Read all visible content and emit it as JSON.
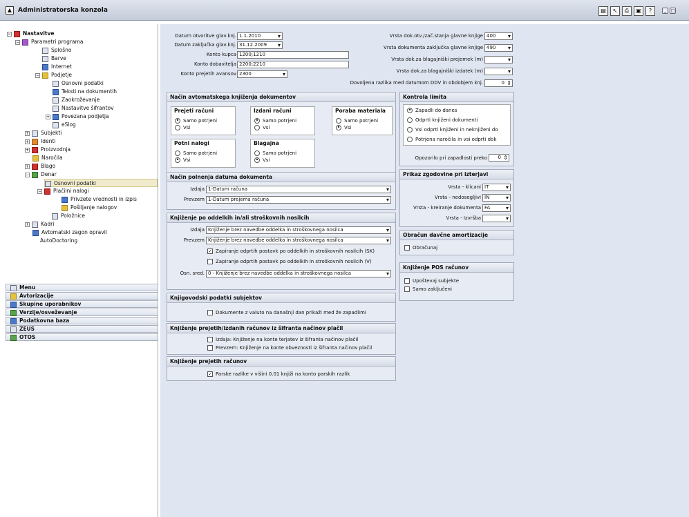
{
  "window": {
    "title": "Administratorska konzola"
  },
  "tree": {
    "items": [
      {
        "label": "Nastavitve",
        "top": "true"
      },
      {
        "label": "Parametri programa"
      },
      {
        "label": "Splošno"
      },
      {
        "label": "Barve"
      },
      {
        "label": "Internet"
      },
      {
        "label": "Podjetje"
      },
      {
        "label": "Osnovni podatki"
      },
      {
        "label": "Teksti na dokumentih"
      },
      {
        "label": "Zaokroževanje"
      },
      {
        "label": "Nastavitve šifrantov"
      },
      {
        "label": "Povezana podjetja"
      },
      {
        "label": "eSlog"
      },
      {
        "label": "Subjekti"
      },
      {
        "label": "Identi"
      },
      {
        "label": "Proizvodnja"
      },
      {
        "label": "Naročila"
      },
      {
        "label": "Blago"
      },
      {
        "label": "Denar"
      },
      {
        "label": "Osnovni podatki"
      },
      {
        "label": "Plačilni nalogi"
      },
      {
        "label": "Privzete vrednosti in izpis"
      },
      {
        "label": "Pošiljanje nalogov"
      },
      {
        "label": "Položnice"
      },
      {
        "label": "Kadri"
      },
      {
        "label": "Avtomatski zagon opravil"
      },
      {
        "label": "AutoDoctoring"
      }
    ],
    "bottom": [
      "Menu",
      "Avtorizacije",
      "Skupine uporabnikov",
      "Verzije/osveževanje",
      "Podatkovna baza",
      "ZEUS",
      "OTOS"
    ]
  },
  "form": {
    "datum_otvoritve_label": "Datum otvoritve glav.knj.",
    "datum_otvoritve": "1.1.2010",
    "datum_zakljucka_label": "Datum zaključka glav.knj.",
    "datum_zakljucka": "31.12.2009",
    "konto_kupca_label": "Konto kupca",
    "konto_kupca": "1200;1210",
    "konto_dobavitelja_label": "Konto dobavitelja",
    "konto_dobavitelja": "2200;2210",
    "konto_prejetih_label": "Konto prejetih avansov",
    "konto_prejetih": "2300",
    "vrsta_otv_label": "Vrsta dok.otv./zač.stanja glavne knjige",
    "vrsta_otv": "400",
    "vrsta_zak_label": "Vrsta dokumenta zaključka glavne knjige",
    "vrsta_zak": "490",
    "vrsta_prejemek_label": "Vrsta dok.za blagajniški prejemek (m)",
    "vrsta_izdatek_label": "Vrsta dok.za blagajniški izdatek (m)",
    "dovoljena_label": "Dovoljena razlika med datumom DDV in obdobjem knj.",
    "dovoljena": "0"
  },
  "avtomatsko": {
    "title": "Način avtomatskega knjiženja dokumentov",
    "prejeti": {
      "title": "Prejeti računi",
      "opt1": "Samo potrjeni",
      "opt2": "Vsi"
    },
    "izdani": {
      "title": "Izdani računi",
      "opt1": "Samo potrjeni",
      "opt2": "Vsi"
    },
    "poraba": {
      "title": "Poraba materiala",
      "opt1": "Samo potrjeni",
      "opt2": "Vsi"
    },
    "potni": {
      "title": "Potni nalogi",
      "opt1": "Samo potrjeni",
      "opt2": "Vsi"
    },
    "blagajna": {
      "title": "Blagajna",
      "opt1": "Samo potrjeni",
      "opt2": "Vsi"
    }
  },
  "datum_doc": {
    "title": "Način polnenja datuma dokumenta",
    "izdaja_label": "Izdaja",
    "izdaja": "1-Datum računa",
    "prevzem_label": "Prevzem",
    "prevzem": "1-Datum prejema računa"
  },
  "oddelki": {
    "title": "Knjiženje po oddelkih in/ali stroškovnih nosilcih",
    "izdaja_label": "Izdaja",
    "izdaja": "Knjiženje brez navedbe oddelka in stroškovnega nosilca",
    "prevzem_label": "Prevzem",
    "prevzem": "Knjiženje brez navedbe oddelka in stroškovnega nosilca",
    "chk1": "Zapiranje odprtih postavk po oddelkih in stroškovnih nosilcih (SK)",
    "chk2": "Zapiranje odprtih postavk po oddelkih in stroškovnih nosilcih (V)",
    "osn_label": "Osn. sred.",
    "osn": "0 - Knjiženje brez navedbe oddelka in stroškovnega nosilca"
  },
  "knjigovodski": {
    "title": "Knjigovodski podatki subjektov",
    "chk": "Dokumente z valuto na današnji dan prikaži med že zapadlimi"
  },
  "sifrant": {
    "title": "Knjiženje prejetih/izdanih računov iz šifranta načinov plačil",
    "chk1": "Izdaja:  Knjiženje na konte terjatev iz šifranta načinov plačil",
    "chk2": "Prevzem: Knjiženje na konte obveznosti iz šifranta načinov plačil"
  },
  "prejetih": {
    "title": "Knjiženje prejetih računov",
    "chk": "Parske razlike v višini  0.01 knjiži na konto parskih razlik"
  },
  "kontrola": {
    "title": "Kontrola limita",
    "opt1": "Zapadli do danes",
    "opt2": "Odprti knjiženi dokumenti",
    "opt3": "Vsi odprti knjiženi in neknjiženi do",
    "opt4": "Potrjena naročila in vsi odprti dok",
    "opozorilo_label": "Opozorilo pri zapadlosti preko",
    "opozorilo": "0"
  },
  "zgodovina": {
    "title": "Prikaz zgodovine pri izterjavi",
    "klicani_label": "Vrsta - klicani",
    "klicani": "IT",
    "nedosegljivi_label": "Vrsta - nedosegljivi",
    "nedosegljivi": "IN",
    "kreiranje_label": "Vrsta - kreiranje dokumenta",
    "kreiranje": "FA",
    "izvrsba_label": "Vrsta - Izvršba"
  },
  "amortizacija": {
    "title": "Obračun davčne amortizacije",
    "chk": "Obračunaj"
  },
  "pos": {
    "title": "Knjiženje POS računov",
    "chk1": "Upoštevaj subjekte",
    "chk2": "Samo zaključeni"
  }
}
